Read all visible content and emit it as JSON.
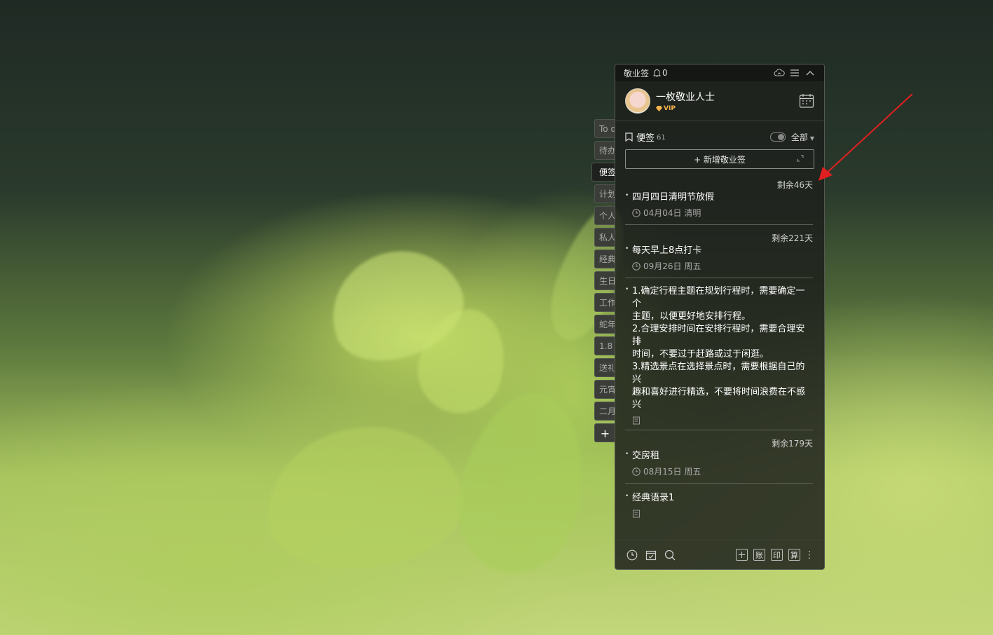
{
  "app": {
    "title": "敬业签",
    "bell_count": "0"
  },
  "user": {
    "name": "一枚敬业人士",
    "badge": "VIP"
  },
  "side_tabs": [
    "To d",
    "待办",
    "便签",
    "计划",
    "个人",
    "私人",
    "经典",
    "生日",
    "工作",
    "蛇年",
    "1.8",
    "送礼",
    "元宵",
    "二月",
    "+"
  ],
  "notes_header": {
    "label": "便签",
    "count": "61",
    "filter": "全部"
  },
  "add_button": {
    "label": "+ 新增敬业签"
  },
  "notes": [
    {
      "remain": "剩余46天",
      "title": "四月四日清明节放假",
      "meta": "04月04日 清明"
    },
    {
      "remain": "剩余221天",
      "title": "每天早上8点打卡",
      "meta": "09月26日 周五"
    },
    {
      "remain": "",
      "title": "1.确定行程主题在规划行程时，需要确定一个\n主题，以便更好地安排行程。\n2.合理安排时间在安排行程时，需要合理安排\n时间，不要过于赶路或过于闲逛。\n3.精选景点在选择景点时，需要根据自己的兴\n趣和喜好进行精选，不要将时间浪费在不感兴",
      "meta": ""
    },
    {
      "remain": "剩余179天",
      "title": "交房租",
      "meta": "08月15日 周五"
    },
    {
      "remain": "",
      "title": "经典语录1",
      "meta": ""
    }
  ],
  "bottom_bar": {
    "buttons": [
      "账",
      "印",
      "算"
    ]
  },
  "colors": {
    "panel_bg": "#1e211d",
    "vip": "#f4b24c",
    "arrow": "#e02020"
  }
}
